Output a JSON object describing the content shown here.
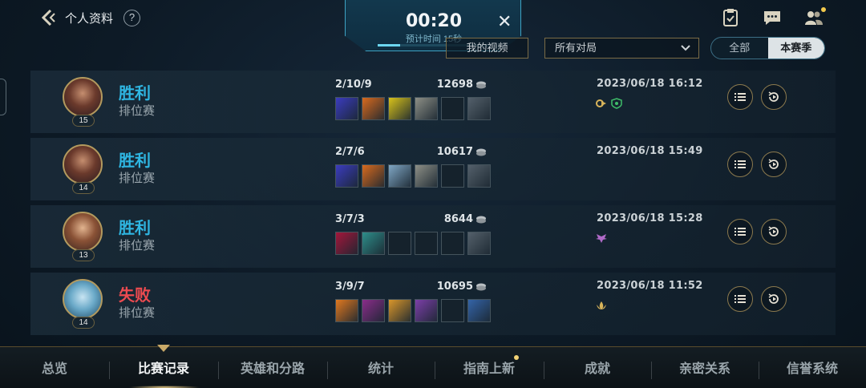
{
  "header": {
    "title": "个人资料",
    "back_icon": "back-chevron-icon",
    "help_label": "?",
    "icons": [
      "clipboard-icon",
      "chat-icon",
      "friends-icon"
    ]
  },
  "timer": {
    "time": "00:20",
    "subtitle": "预计时间 15秒",
    "close_label": "✕"
  },
  "filters": {
    "video_label": "我的视频",
    "match_select": "所有对局",
    "toggle": {
      "all": "全部",
      "season": "本赛季",
      "selected": "本赛季"
    }
  },
  "matches": [
    {
      "result": "胜利",
      "outcome": "win",
      "mode": "排位赛",
      "level": "15",
      "kda": "2/10/9",
      "gold": "12698",
      "date": "2023/06/18 16:12",
      "badges": [
        "mvp-icon",
        "shield-icon"
      ]
    },
    {
      "result": "胜利",
      "outcome": "win",
      "mode": "排位赛",
      "level": "14",
      "kda": "2/7/6",
      "gold": "10617",
      "date": "2023/06/18 15:49",
      "badges": []
    },
    {
      "result": "胜利",
      "outcome": "win",
      "mode": "排位赛",
      "level": "13",
      "kda": "3/7/3",
      "gold": "8644",
      "date": "2023/06/18 15:28",
      "badges": [
        "wings-icon"
      ]
    },
    {
      "result": "失败",
      "outcome": "loss",
      "mode": "排位赛",
      "level": "14",
      "kda": "3/9/7",
      "gold": "10695",
      "date": "2023/06/18 11:52",
      "badges": [
        "lotus-icon"
      ]
    }
  ],
  "nav": {
    "tabs": [
      "总览",
      "比赛记录",
      "英雄和分路",
      "统计",
      "指南上新",
      "成就",
      "亲密关系",
      "信誉系统"
    ],
    "active": "比赛记录"
  },
  "colors": {
    "win": "#2fb6e2",
    "loss": "#ec4b50",
    "accent_gold": "#b39a5e"
  }
}
